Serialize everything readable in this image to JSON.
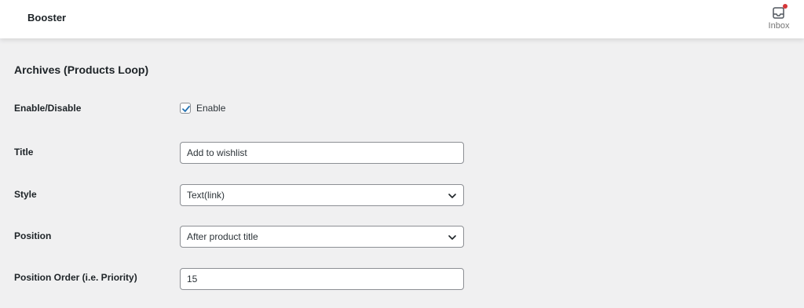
{
  "header": {
    "app_title": "Booster",
    "inbox_label": "Inbox",
    "inbox_icon": "inbox-icon",
    "notification_color": "#d63638"
  },
  "section": {
    "title": "Archives (Products Loop)"
  },
  "fields": {
    "enable": {
      "label": "Enable/Disable",
      "checkbox_label": "Enable",
      "checked": true
    },
    "title": {
      "label": "Title",
      "value": "Add to wishlist"
    },
    "style": {
      "label": "Style",
      "selected": "Text(link)"
    },
    "position": {
      "label": "Position",
      "selected": "After product title"
    },
    "position_order": {
      "label": "Position Order (i.e. Priority)",
      "value": "15"
    }
  }
}
